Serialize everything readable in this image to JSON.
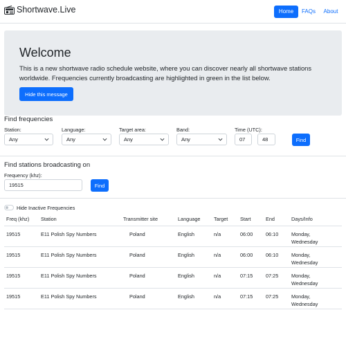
{
  "navbar": {
    "brand": "Shortwave.Live",
    "links": [
      {
        "label": "Home",
        "active": true
      },
      {
        "label": "FAQs"
      },
      {
        "label": "About"
      }
    ]
  },
  "hero": {
    "title": "Welcome",
    "description": "This is a new shortwave radio schedule website, where you can discover nearly all shortwave stations worldwide. Frequencies currently broadcasting are highlighted in green in the list below.",
    "hide_button": "Hide this message"
  },
  "find_frequencies": {
    "title": "Find frequencies",
    "station": {
      "label": "Station:",
      "value": "Any"
    },
    "language": {
      "label": "Language:",
      "value": "Any"
    },
    "target": {
      "label": "Target area:",
      "value": "Any"
    },
    "band": {
      "label": "Band:",
      "value": "Any"
    },
    "time": {
      "label": "Time (UTC):",
      "hour": "07",
      "minute": "48"
    },
    "find_button": "Find"
  },
  "find_stations": {
    "title": "Find stations broadcasting on",
    "freq_label": "Frequency (khz):",
    "freq_value": "19515",
    "find_button": "Find"
  },
  "toggle": {
    "label": "Hide Inactive Frequencies",
    "on": false
  },
  "table": {
    "headers": [
      "Freq (khz)",
      "Station",
      "Transmitter site",
      "Language",
      "Target",
      "Start",
      "End",
      "Days/Info"
    ],
    "rows": [
      {
        "freq": "19515",
        "station": "E11 Polish Spy Numbers",
        "site": "Poland",
        "language": "English",
        "target": "n/a",
        "start": "06:00",
        "end": "06:10",
        "days1": "Monday,",
        "days2": "Wednesday"
      },
      {
        "freq": "19515",
        "station": "E11 Polish Spy Numbers",
        "site": "Poland",
        "language": "English",
        "target": "n/a",
        "start": "06:00",
        "end": "06:10",
        "days1": "Monday,",
        "days2": "Wednesday"
      },
      {
        "freq": "19515",
        "station": "E11 Polish Spy Numbers",
        "site": "Poland",
        "language": "English",
        "target": "n/a",
        "start": "07:15",
        "end": "07:25",
        "days1": "Monday,",
        "days2": "Wednesday"
      },
      {
        "freq": "19515",
        "station": "E11 Polish Spy Numbers",
        "site": "Poland",
        "language": "English",
        "target": "n/a",
        "start": "07:15",
        "end": "07:25",
        "days1": "Monday,",
        "days2": "Wednesday"
      }
    ]
  },
  "colors": {
    "primary": "#0d6efd",
    "hero_bg": "#e9ecef",
    "border": "#dee2e6"
  }
}
